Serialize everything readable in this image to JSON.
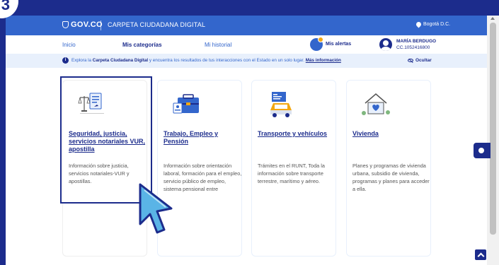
{
  "step": {
    "number": "3"
  },
  "gov_bar": {
    "logo_text": "GOV.CO",
    "portal_title": "CARPETA CIUDADANA DIGITAL",
    "location": "Bogotá D.C."
  },
  "nav": {
    "items": [
      {
        "label": "Inicio"
      },
      {
        "label": "Mis categorías"
      },
      {
        "label": "Mi historial"
      }
    ],
    "alerts_label": "Mis alertas",
    "user_name": "MARÍA BERDUGO",
    "user_id": "CC.1052416800"
  },
  "info_bar": {
    "text_before": "Explora la",
    "text_bold": "Carpeta Ciudadana Digital",
    "text_after": "y encuentra los resultados de tus interacciones con el Estado en un solo lugar.",
    "more_label": "Más información",
    "hide_label": "Ocultar"
  },
  "cards": [
    {
      "title": "Seguridad, justicia, servicios notariales VUR, apostilla",
      "description": "Información sobre justicia, servicios notariales-VUR y apostillas."
    },
    {
      "title": "Trabajo, Empleo y Pensión",
      "description": "Información sobre orientación laboral, formación para el empleo, servicio público de empleo, sistema pensional entre"
    },
    {
      "title": "Transporte y vehículos",
      "description": "Trámites en el RUNT, Toda la información sobre transporte terrestre, marítimo y aéreo."
    },
    {
      "title": "Vivienda",
      "description": "Planes y programas de vivienda urbana, subsidio de vivienda, programas y planes para acceder a ella."
    }
  ],
  "colors": {
    "primary": "#3366cc",
    "navy": "#1c2c8c",
    "background": "#1c2c8c"
  }
}
